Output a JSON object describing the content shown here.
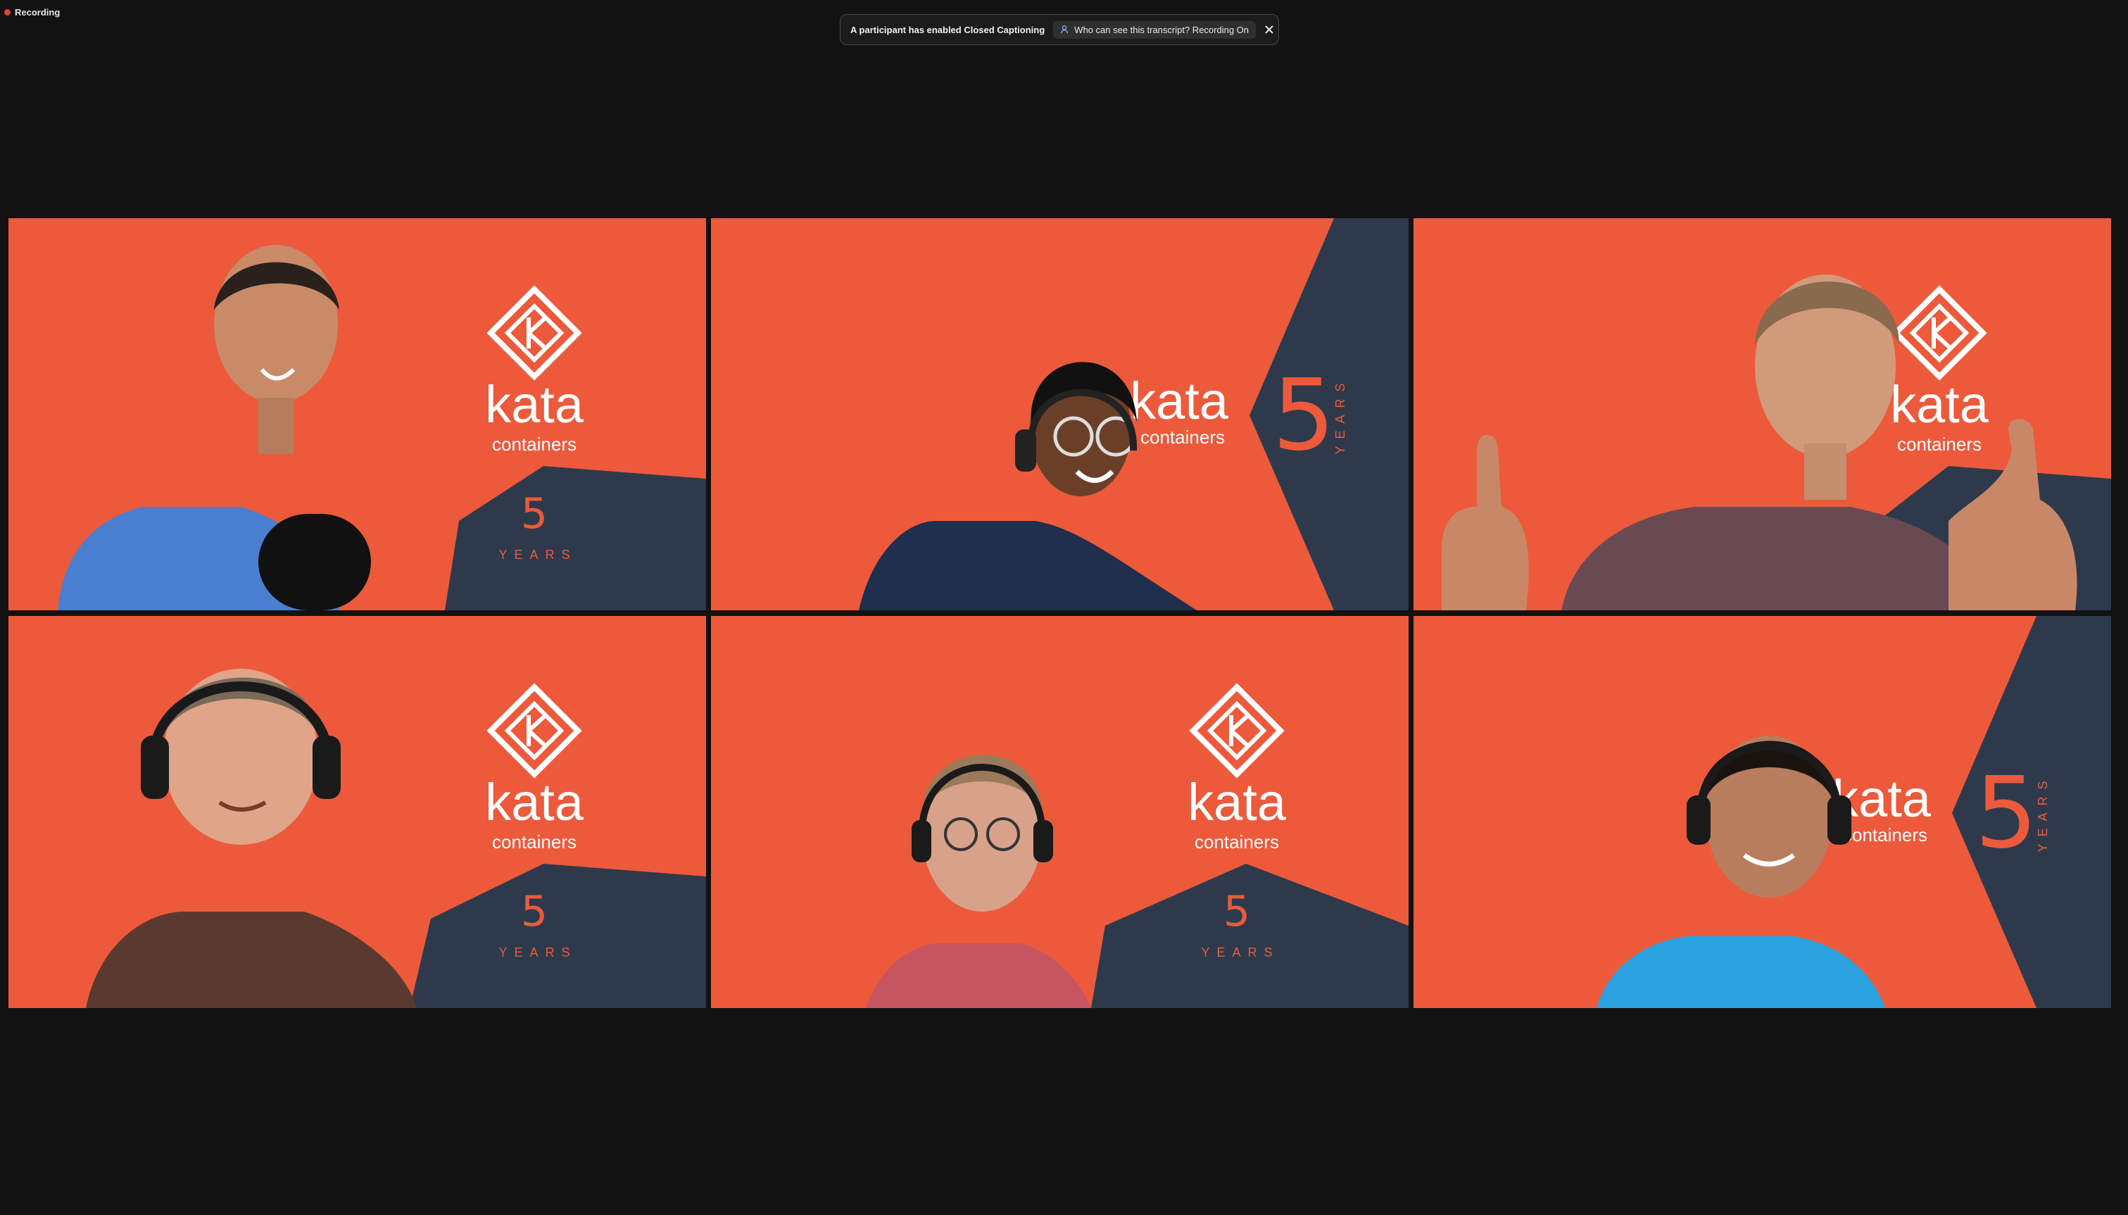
{
  "recording": {
    "label": "Recording",
    "color": "#e0423a"
  },
  "banner": {
    "message": "A participant has enabled Closed Captioning",
    "pill": "Who can see this transcript? Recording On",
    "close_icon": "close-icon",
    "person_icon": "person-icon"
  },
  "colors": {
    "background": "#121212",
    "brand_orange": "#ec5a3b",
    "brand_navy": "#2e3a4c",
    "active_speaker": "#3fbf4a"
  },
  "brand": {
    "name": "kata",
    "sub": "containers",
    "years_number": "5",
    "years_word": "YEARS"
  },
  "tiles": [
    {
      "id": "participant-1",
      "active": false,
      "layout": "logo-right"
    },
    {
      "id": "participant-2",
      "active": true,
      "layout": "wedge-right"
    },
    {
      "id": "participant-3",
      "active": false,
      "layout": "logo-right"
    },
    {
      "id": "participant-4",
      "active": false,
      "layout": "logo-right"
    },
    {
      "id": "participant-5",
      "active": false,
      "layout": "logo-right"
    },
    {
      "id": "participant-6",
      "active": false,
      "layout": "wedge-right"
    }
  ]
}
